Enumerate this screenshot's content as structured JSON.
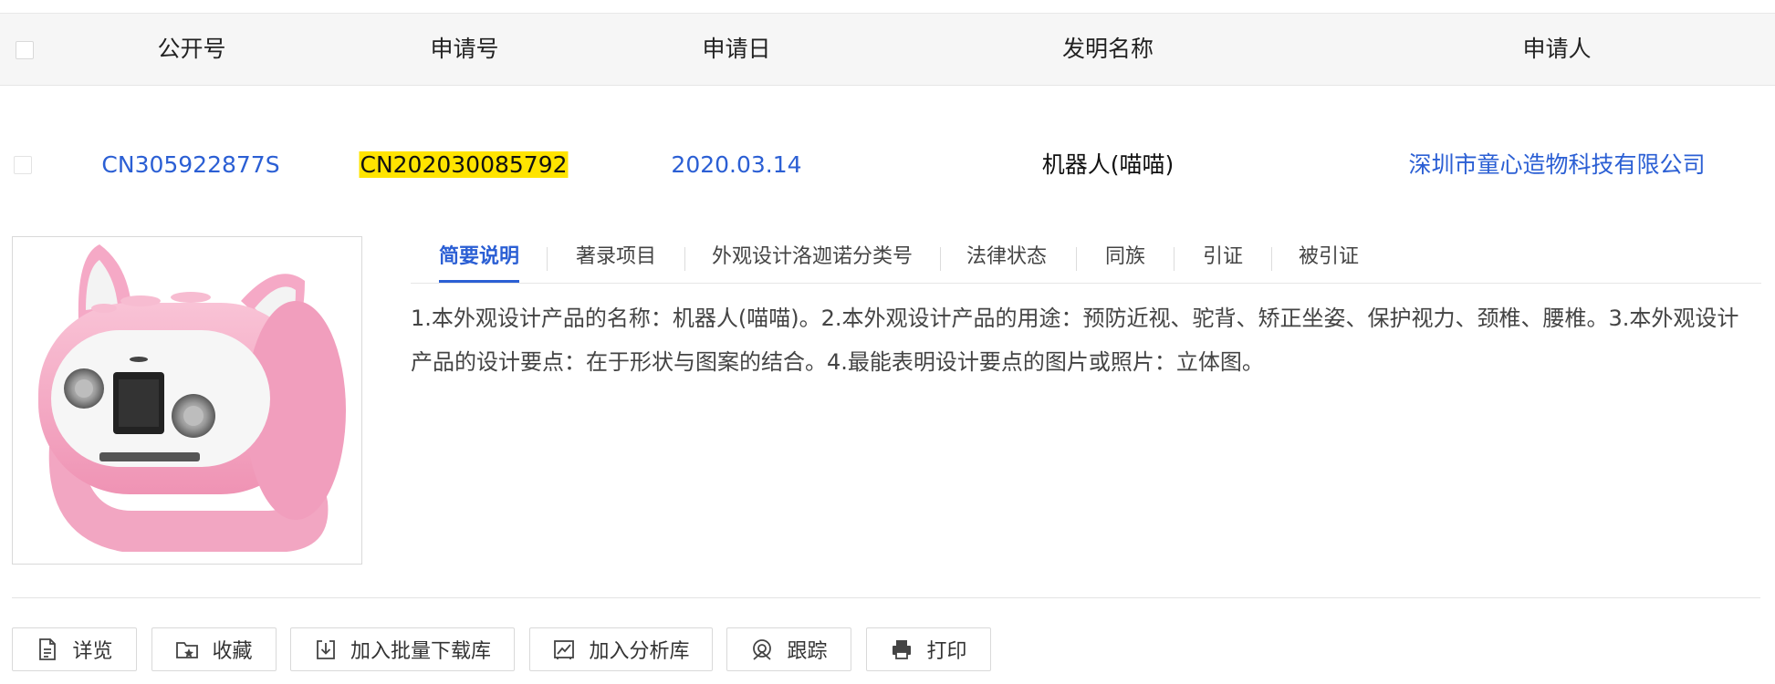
{
  "table": {
    "headers": {
      "pub_no": "公开号",
      "app_no": "申请号",
      "app_date": "申请日",
      "title": "发明名称",
      "applicant": "申请人"
    },
    "row": {
      "pub_no": "CN305922877S",
      "app_no": "CN202030085792",
      "app_date": "2020.03.14",
      "title": "机器人(喵喵)",
      "applicant": "深圳市童心造物科技有限公司"
    }
  },
  "tabs": [
    {
      "label": "简要说明",
      "active": true
    },
    {
      "label": "著录项目",
      "active": false
    },
    {
      "label": "外观设计洛迦诺分类号",
      "active": false
    },
    {
      "label": "法律状态",
      "active": false
    },
    {
      "label": "同族",
      "active": false
    },
    {
      "label": "引证",
      "active": false
    },
    {
      "label": "被引证",
      "active": false
    }
  ],
  "description": "1.本外观设计产品的名称：机器人(喵喵)。2.本外观设计产品的用途：预防近视、驼背、矫正坐姿、保护视力、颈椎、腰椎。3.本外观设计产品的设计要点：在于形状与图案的结合。4.最能表明设计要点的图片或照片：立体图。",
  "actions": {
    "detail": {
      "label": "详览",
      "icon": "document-icon"
    },
    "favorite": {
      "label": "收藏",
      "icon": "folder-star-icon"
    },
    "batch_download": {
      "label": "加入批量下载库",
      "icon": "download-icon"
    },
    "analysis": {
      "label": "加入分析库",
      "icon": "chart-icon"
    },
    "track": {
      "label": "跟踪",
      "icon": "track-icon"
    },
    "print": {
      "label": "打印",
      "icon": "printer-icon"
    }
  },
  "colors": {
    "link": "#2b5fd4",
    "highlight": "#ffe400",
    "product_pink": "#f4a9c4"
  }
}
